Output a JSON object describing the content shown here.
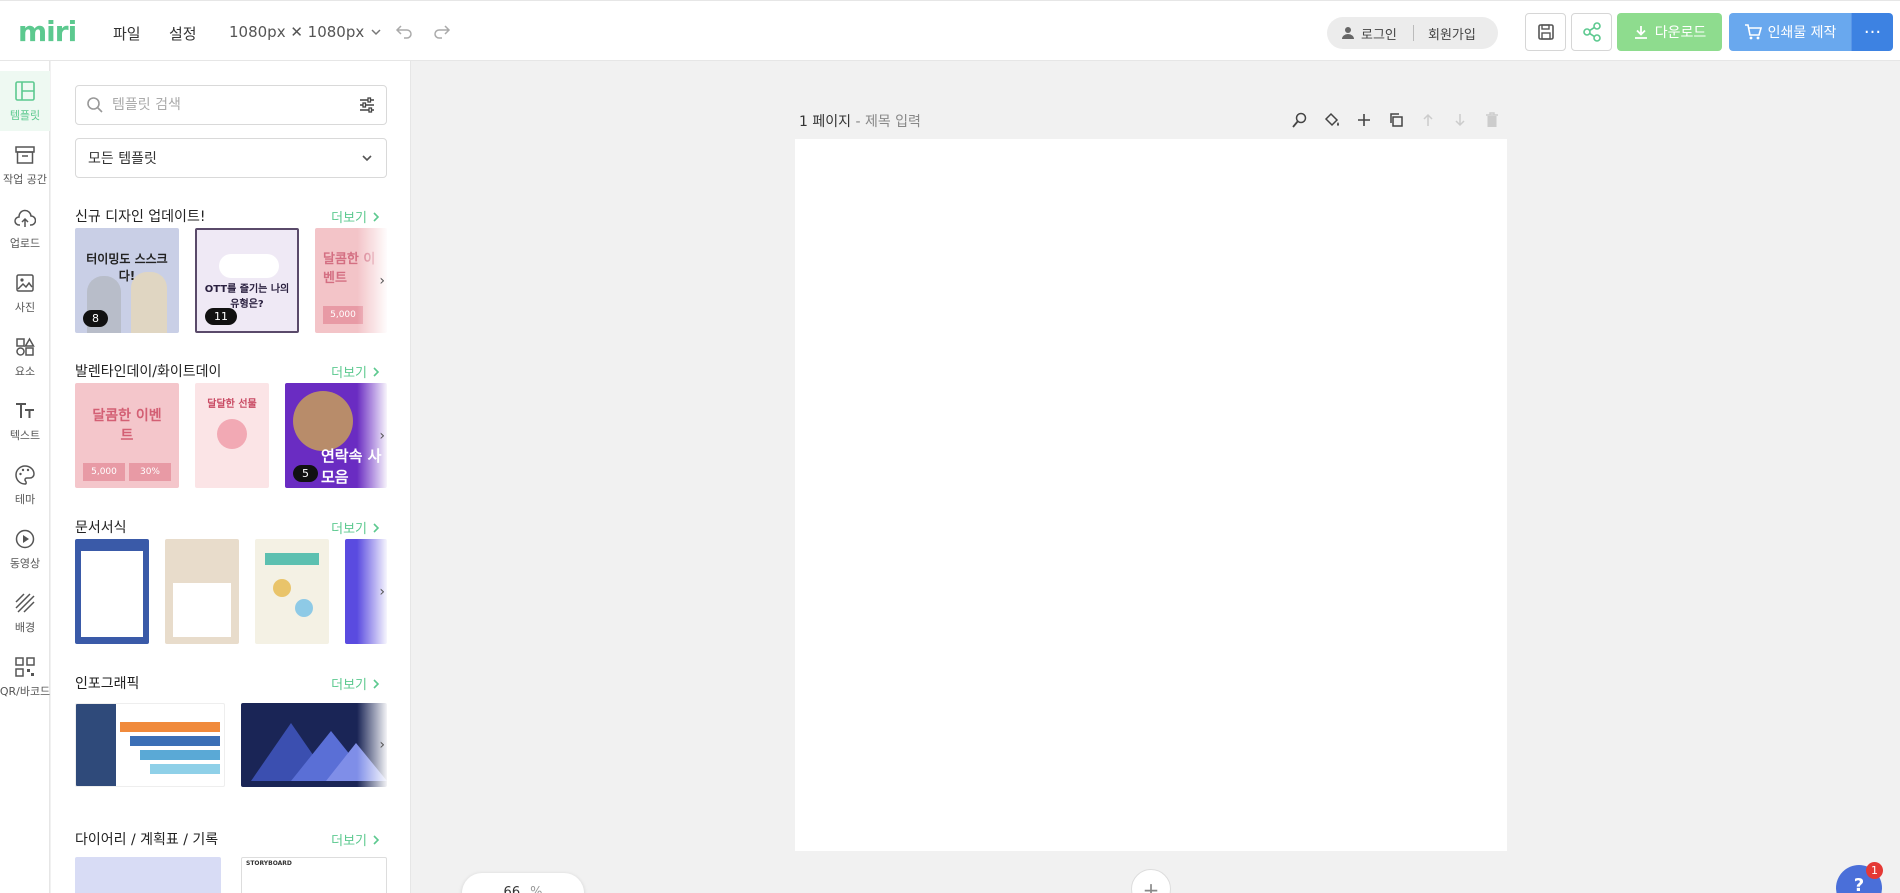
{
  "header": {
    "logo": "miri",
    "menu_file": "파일",
    "menu_settings": "설정",
    "canvas_size": "1080px ✕ 1080px",
    "login": "로그인",
    "signup": "회원가입",
    "download": "다운로드",
    "print": "인쇄물 제작",
    "more": "···"
  },
  "rail": {
    "items": [
      {
        "label": "템플릿"
      },
      {
        "label": "작업 공간"
      },
      {
        "label": "업로드"
      },
      {
        "label": "사진"
      },
      {
        "label": "요소"
      },
      {
        "label": "텍스트"
      },
      {
        "label": "테마"
      },
      {
        "label": "동영상"
      },
      {
        "label": "배경"
      },
      {
        "label": "QR/바코드"
      }
    ]
  },
  "panel": {
    "search_placeholder": "템플릿 검색",
    "dropdown_value": "모든 템플릿",
    "more_label": "더보기",
    "sections": [
      {
        "title": "신규 디자인 업데이트!",
        "badges": [
          "8",
          "11"
        ]
      },
      {
        "title": "발렌타인데이/화이트데이",
        "badges": [
          "5"
        ]
      },
      {
        "title": "문서서식",
        "badges": []
      },
      {
        "title": "인포그래픽",
        "badges": []
      },
      {
        "title": "다이어리 / 계획표 / 기록",
        "badges": []
      }
    ],
    "thumb_texts": {
      "t1": "터이밍도 스스크다!",
      "t2": "OTT를 즐기는 나의 유형은?",
      "t3": "달콤한 이벤트",
      "t4": "5,000",
      "t5": "30%",
      "t6": "달달한 선물",
      "t7": "연락속 사 모음",
      "t8": "STORYBOARD"
    }
  },
  "page": {
    "label": "1 페이지",
    "title_placeholder": "- 제목 입력",
    "zoom_value": "66",
    "zoom_unit": "%"
  },
  "help": {
    "label": "?",
    "badge": "1"
  },
  "colors": {
    "brand": "#5cc98f",
    "download": "#8edc8e",
    "print": "#69a8ee",
    "more": "#3d82e2"
  }
}
